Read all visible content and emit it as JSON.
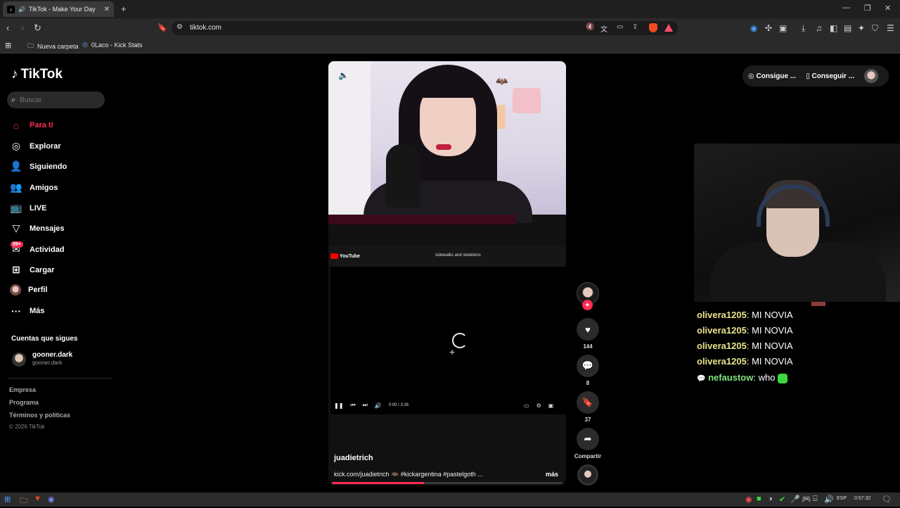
{
  "browser": {
    "tab_title": "TikTok - Make Your Day",
    "url": "tiktok.com",
    "bookmarks": [
      "Nueva carpeta",
      "0Laco - Kick Stats"
    ]
  },
  "sidebar": {
    "logo": "TikTok",
    "search_placeholder": "Buscar",
    "items": [
      {
        "label": "Para ti",
        "icon": "home-icon",
        "active": true
      },
      {
        "label": "Explorar",
        "icon": "compass-icon"
      },
      {
        "label": "Siguiendo",
        "icon": "following-icon"
      },
      {
        "label": "Amigos",
        "icon": "friends-icon"
      },
      {
        "label": "LIVE",
        "icon": "live-icon"
      },
      {
        "label": "Mensajes",
        "icon": "messages-icon"
      },
      {
        "label": "Actividad",
        "icon": "activity-icon",
        "badge": "99+"
      },
      {
        "label": "Cargar",
        "icon": "upload-icon"
      },
      {
        "label": "Perfil",
        "icon": "profile-avatar"
      },
      {
        "label": "Más",
        "icon": "more-icon"
      }
    ],
    "following_title": "Cuentas que sigues",
    "following": [
      {
        "name": "gooner.dark",
        "handle": "gooner.dark"
      }
    ],
    "footer": [
      "Empresa",
      "Programa",
      "Términos y políticas"
    ],
    "copyright": "© 2026 TikTok"
  },
  "video": {
    "yt_logo": "YouTube",
    "yt_title": "sidewalks and skeletons",
    "yt_time": "0:00 / 3:26",
    "author": "juadietrich",
    "description": "kick.com/juadietrich 🦇 #kickargentina #pastelgoth ...",
    "more": "más",
    "progress": 0.4
  },
  "actions": {
    "likes": "144",
    "comments": "8",
    "saves": "37",
    "share": "Compartir"
  },
  "topbar": {
    "btn1": "Consigue ...",
    "btn2": "Conseguir ..."
  },
  "chat": [
    {
      "user": "olivera1205",
      "text": ": MI NOVIA"
    },
    {
      "user": "olivera1205",
      "text": ": MI NOVIA"
    },
    {
      "user": "olivera1205",
      "text": ": MI NOVIA"
    },
    {
      "user": "olivera1205",
      "text": ": MI NOVIA"
    },
    {
      "user": "nefaustow",
      "text": ": who"
    }
  ],
  "taskbar": {
    "lang": "ESP",
    "time": "0:57:32"
  },
  "colors": {
    "accent": "#fe2c55",
    "chat_user": "#e7e38a",
    "chat_user_alt": "#7fe37f"
  }
}
